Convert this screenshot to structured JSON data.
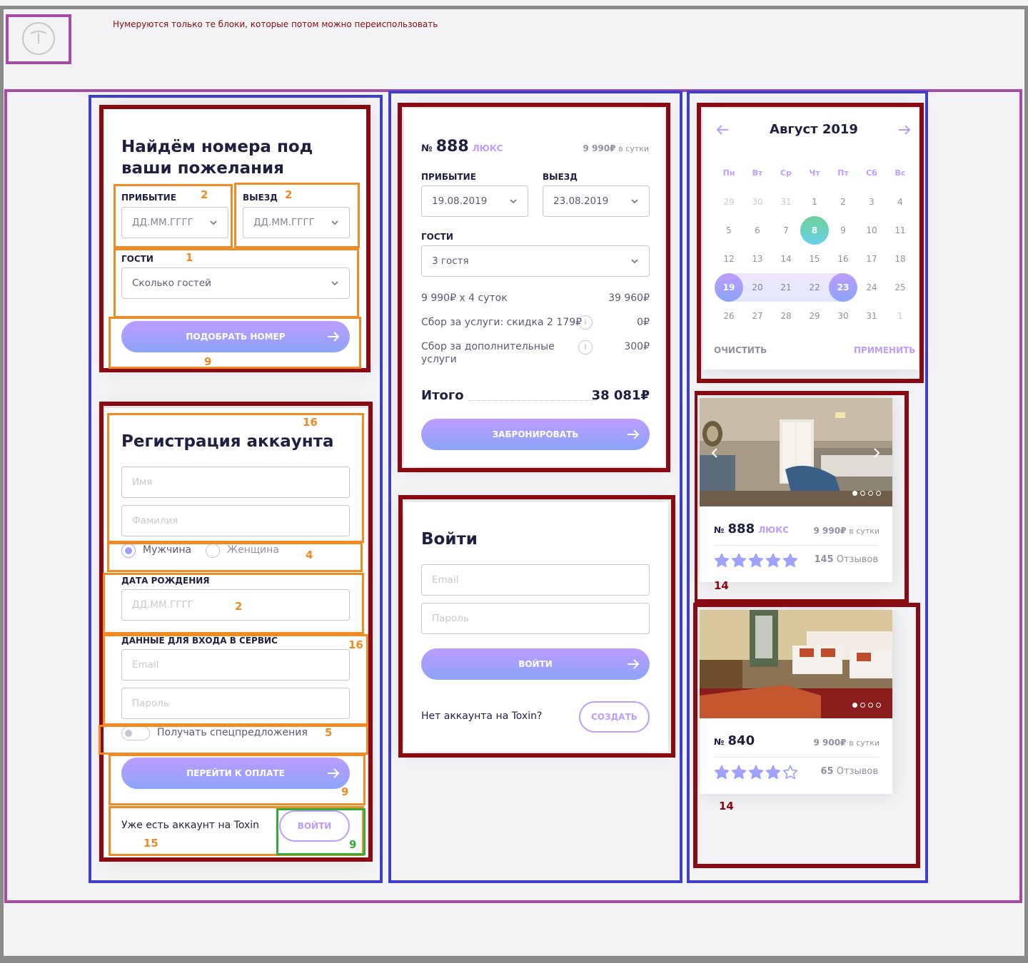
{
  "note": "Нумеруются только те блоки, которые потом можно переиспользовать",
  "logo_icon": "logo-icon",
  "colors": {
    "accent": "#bc9cff",
    "accent2": "#8ba4f9",
    "text": "#1f2041",
    "frame_purple": "#a64ca6",
    "frame_blue": "#3f3fcf",
    "frame_red": "#8a0a13",
    "frame_orange": "#f08a24",
    "frame_green": "#2fae3a",
    "today_green": "#6fcf97"
  },
  "search": {
    "title_line1": "Найдём номера под",
    "title_line2": "ваши пожелания",
    "arrival_label": "ПРИБЫТИЕ",
    "arrival_placeholder": "ДД.ММ.ГГГГ",
    "departure_label": "ВЫЕЗД",
    "departure_placeholder": "ДД.ММ.ГГГГ",
    "guests_label": "ГОСТИ",
    "guests_value": "Сколько гостей",
    "submit": "ПОДОБРАТЬ НОМЕР",
    "num_arrival": "2",
    "num_departure": "2",
    "num_guests": "1",
    "num_submit": "9"
  },
  "registration": {
    "num_title": "16",
    "title": "Регистрация аккаунта",
    "first_name_placeholder": "Имя",
    "last_name_placeholder": "Фамилия",
    "gender_male": "Мужчина",
    "gender_female": "Женщина",
    "num_gender": "4",
    "birthdate_label": "ДАТА РОЖДЕНИЯ",
    "birthdate_placeholder": "ДД.ММ.ГГГГ",
    "num_birthdate": "2",
    "credentials_label": "ДАННЫЕ ДЛЯ ВХОДА В СЕРВИС",
    "num_credentials": "16",
    "email_placeholder": "Email",
    "password_placeholder": "Пароль",
    "offers_toggle": "Получать спецпредложения",
    "num_offers": "5",
    "submit": "ПЕРЕЙТИ К ОПЛАТЕ",
    "num_submit": "9",
    "have_account": "Уже есть аккаунт на Toxin",
    "login_button": "ВОЙТИ",
    "num_have_account": "15",
    "num_login": "9"
  },
  "booking": {
    "room_prefix": "№",
    "room_number": "888",
    "room_type": "ЛЮКС",
    "price": "9 990₽",
    "price_unit": "в сутки",
    "arrival_label": "ПРИБЫТИЕ",
    "arrival_value": "19.08.2019",
    "departure_label": "ВЫЕЗД",
    "departure_value": "23.08.2019",
    "guests_label": "ГОСТИ",
    "guests_value": "3 гостя",
    "line1_label": "9 990₽ х 4 суток",
    "line1_value": "39 960₽",
    "line2_label": "Сбор за услуги: скидка 2 179₽",
    "line2_value": "0₽",
    "line3_label_1": "Сбор за дополнительные",
    "line3_label_2": "услуги",
    "line3_value": "300₽",
    "total_label": "Итого",
    "total_value": "38 081₽",
    "submit": "ЗАБРОНИРОВАТЬ"
  },
  "login": {
    "title": "Войти",
    "email_placeholder": "Email",
    "password_placeholder": "Пароль",
    "submit": "ВОЙТИ",
    "no_account": "Нет аккаунта на Toxin?",
    "create": "СОЗДАТЬ"
  },
  "calendar": {
    "month": "Август 2019",
    "weekdays": [
      "Пн",
      "Вт",
      "Ср",
      "Чт",
      "Пт",
      "Сб",
      "Вс"
    ],
    "days": [
      [
        "29",
        "30",
        "31",
        "1",
        "2",
        "3",
        "4"
      ],
      [
        "5",
        "6",
        "7",
        "8",
        "9",
        "10",
        "11"
      ],
      [
        "12",
        "13",
        "14",
        "15",
        "16",
        "17",
        "18"
      ],
      [
        "19",
        "20",
        "21",
        "22",
        "23",
        "24",
        "25"
      ],
      [
        "26",
        "27",
        "28",
        "29",
        "30",
        "31",
        "1"
      ]
    ],
    "today": "8",
    "range_start": "19",
    "range_end": "23",
    "clear": "ОЧИСТИТЬ",
    "apply": "ПРИМЕНИТЬ"
  },
  "rooms": [
    {
      "prefix": "№",
      "number": "888",
      "type": "ЛЮКС",
      "price": "9 990₽",
      "price_unit": "в сутки",
      "rating": 5,
      "reviews_count": "145",
      "reviews_label": "Отзывов",
      "num": "14"
    },
    {
      "prefix": "№",
      "number": "840",
      "type": "",
      "price": "9 900₽",
      "price_unit": "в сутки",
      "rating": 4,
      "reviews_count": "65",
      "reviews_label": "Отзывов",
      "num": "14"
    }
  ]
}
